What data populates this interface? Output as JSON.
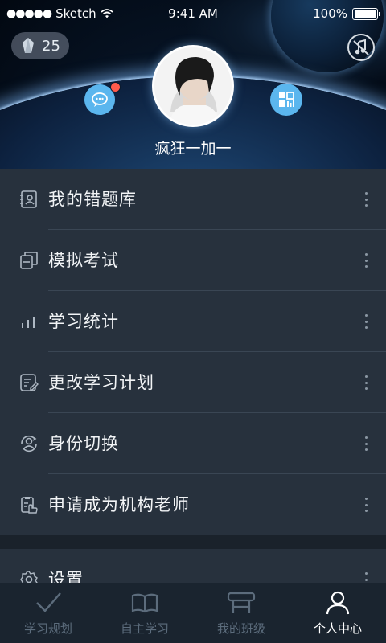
{
  "status_bar": {
    "carrier": "Sketch",
    "time": "9:41 AM",
    "battery": "100%"
  },
  "profile": {
    "gem_count": "25",
    "username": "疯狂一加一"
  },
  "menu": [
    {
      "label": "我的错题库",
      "icon": "wrong-answers-book-icon"
    },
    {
      "label": "模拟考试",
      "icon": "mock-exam-icon"
    },
    {
      "label": "学习统计",
      "icon": "statistics-icon"
    },
    {
      "label": "更改学习计划",
      "icon": "edit-plan-icon"
    },
    {
      "label": "身份切换",
      "icon": "switch-identity-icon"
    },
    {
      "label": "申请成为机构老师",
      "icon": "apply-teacher-icon"
    }
  ],
  "settings": {
    "label": "设置"
  },
  "tabs": [
    {
      "label": "学习规划",
      "icon": "checkmark-icon"
    },
    {
      "label": "自主学习",
      "icon": "open-book-icon"
    },
    {
      "label": "我的班级",
      "icon": "classroom-desk-icon"
    },
    {
      "label": "个人中心",
      "icon": "person-icon"
    }
  ],
  "colors": {
    "accent_blue": "#5bb6ee",
    "notification_red": "#ff5b4c",
    "menu_bg": "#27313d",
    "tabbar_bg": "#1a242f"
  }
}
